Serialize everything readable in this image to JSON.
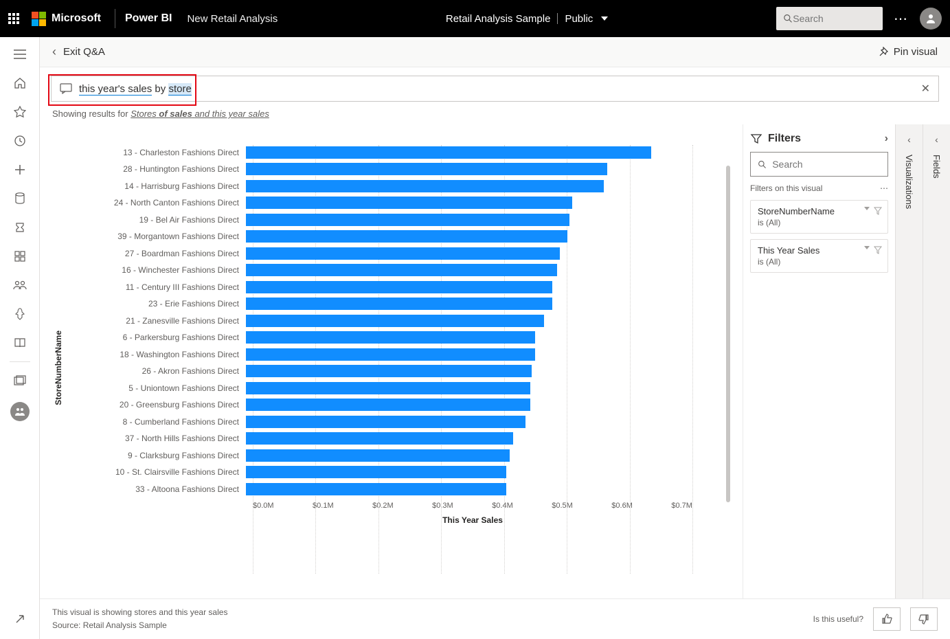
{
  "header": {
    "ms_label": "Microsoft",
    "product": "Power BI",
    "report_name": "New Retail Analysis",
    "workspace": "Retail Analysis Sample",
    "visibility": "Public",
    "search_placeholder": "Search"
  },
  "subbar": {
    "exit_label": "Exit Q&A",
    "pin_label": "Pin visual"
  },
  "qna": {
    "prefix": "this year's sales",
    "mid": "by",
    "highlight": "store",
    "results_prefix": "Showing results for",
    "results_term_a": "Stores",
    "results_term_b": "of sales",
    "results_term_c": "and this year sales"
  },
  "chart_data": {
    "type": "bar",
    "orientation": "horizontal",
    "ylabel": "StoreNumberName",
    "xlabel": "This Year Sales",
    "xticks": [
      "$0.0M",
      "$0.1M",
      "$0.2M",
      "$0.3M",
      "$0.4M",
      "$0.5M",
      "$0.6M",
      "$0.7M"
    ],
    "xlim": [
      0,
      0.7
    ],
    "series": [
      {
        "name": "This Year Sales",
        "color": "#118dff",
        "categories": [
          "13 - Charleston Fashions Direct",
          "28 - Huntington Fashions Direct",
          "14 - Harrisburg Fashions Direct",
          "24 - North Canton Fashions Direct",
          "19 - Bel Air Fashions Direct",
          "39 - Morgantown Fashions Direct",
          "27 - Boardman Fashions Direct",
          "16 - Winchester Fashions Direct",
          "11 - Century III Fashions Direct",
          "23 - Erie Fashions Direct",
          "21 - Zanesville Fashions Direct",
          "6 - Parkersburg Fashions Direct",
          "18 - Washington Fashions Direct",
          "26 - Akron Fashions Direct",
          "5 - Uniontown Fashions Direct",
          "20 - Greensburg Fashions Direct",
          "8 - Cumberland Fashions Direct",
          "37 - North Hills Fashions Direct",
          "9 - Clarksburg Fashions Direct",
          "10 - St. Clairsville Fashions Direct",
          "33 - Altoona Fashions Direct"
        ],
        "values": [
          0.645,
          0.575,
          0.57,
          0.52,
          0.515,
          0.512,
          0.5,
          0.495,
          0.488,
          0.488,
          0.475,
          0.46,
          0.46,
          0.455,
          0.453,
          0.453,
          0.445,
          0.425,
          0.42,
          0.415,
          0.415
        ]
      }
    ]
  },
  "filters": {
    "title": "Filters",
    "search_placeholder": "Search",
    "section_label": "Filters on this visual",
    "cards": [
      {
        "name": "StoreNumberName",
        "value": "is (All)"
      },
      {
        "name": "This Year Sales",
        "value": "is (All)"
      }
    ]
  },
  "side_tabs": {
    "viz": "Visualizations",
    "fields": "Fields"
  },
  "footer": {
    "line1": "This visual is showing stores and this year sales",
    "line2": "Source: Retail Analysis Sample",
    "useful": "Is this useful?"
  }
}
